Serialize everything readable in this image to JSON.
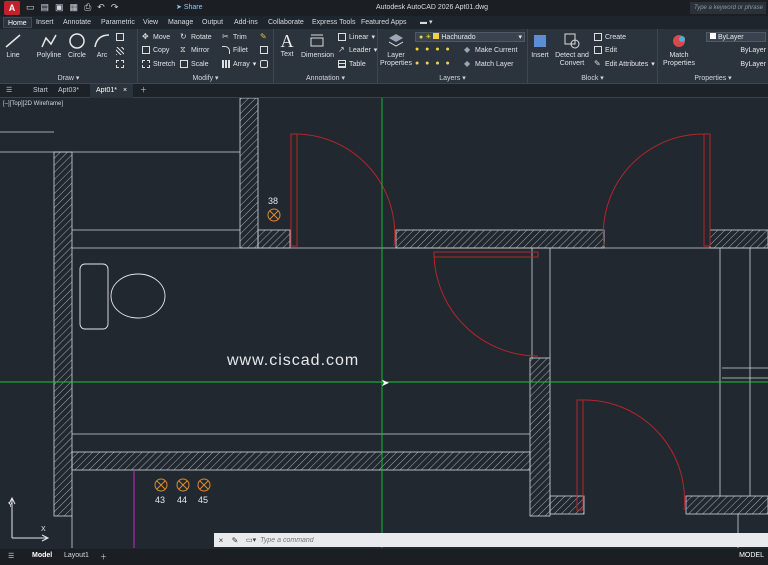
{
  "window": {
    "title": "Autodesk AutoCAD 2026    Apt01.dwg",
    "share": "Share",
    "search_placeholder": "Type a keyword or phrase"
  },
  "ribbon_tabs": [
    "Home",
    "Insert",
    "Annotate",
    "Parametric",
    "View",
    "Manage",
    "Output",
    "Add-ins",
    "Collaborate",
    "Express Tools",
    "Featured Apps"
  ],
  "draw": {
    "line": "Line",
    "polyline": "Polyline",
    "circle": "Circle",
    "arc": "Arc",
    "label": "Draw"
  },
  "modify": {
    "move": "Move",
    "rotate": "Rotate",
    "trim": "Trim",
    "copy": "Copy",
    "mirror": "Mirror",
    "fillet": "Fillet",
    "stretch": "Stretch",
    "scale": "Scale",
    "array": "Array",
    "label": "Modify"
  },
  "annotation": {
    "text": "Text",
    "dimension": "Dimension",
    "linear": "Linear",
    "leader": "Leader",
    "table": "Table",
    "label": "Annotation"
  },
  "layers": {
    "layer_properties": "Layer Properties",
    "current_layer": "Hachurado",
    "make_current": "Make Current",
    "match_layer": "Match Layer",
    "label": "Layers"
  },
  "block": {
    "insert": "Insert",
    "detect": "Detect and Convert",
    "create": "Create",
    "edit": "Edit",
    "edit_attributes": "Edit Attributes",
    "label": "Block"
  },
  "properties": {
    "match": "Match Properties",
    "color": "ByLayer",
    "linetype": "ByLayer",
    "lineweight": "ByLayer",
    "label": "Properties"
  },
  "doc_tabs": [
    "Start",
    "Apt03*",
    "Apt01*"
  ],
  "view_label": "[–][Top][2D Wireframe]",
  "watermark": "www.ciscad.com",
  "lights": {
    "top": "38",
    "bottom": [
      "43",
      "44",
      "45"
    ]
  },
  "command": {
    "placeholder": "Type a command"
  },
  "status": {
    "model_tab": "Model",
    "layout_tab": "Layout1",
    "space": "MODEL"
  },
  "colors": {
    "door": "#b3262b",
    "crosshair": "#1fbf3a",
    "wall": "#cfd3d8",
    "accent": "#c4202b"
  }
}
